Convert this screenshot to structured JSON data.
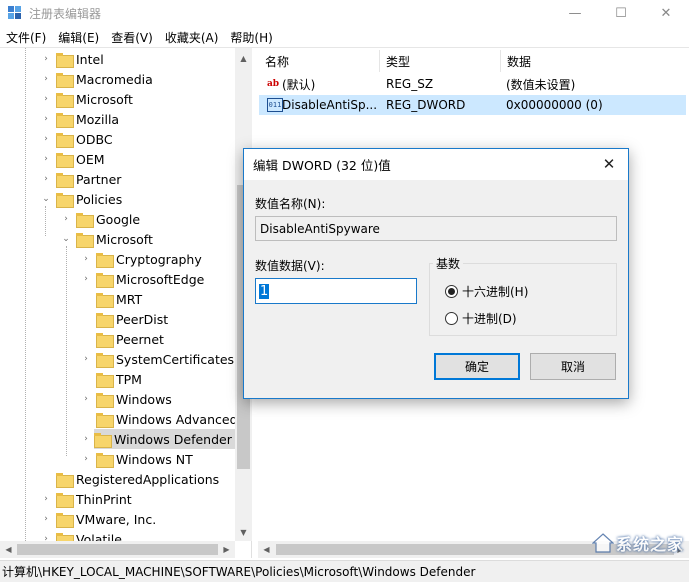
{
  "window": {
    "title": "注册表编辑器",
    "controls": {
      "minimize": "—",
      "maximize": "☐",
      "close": "✕"
    }
  },
  "menubar": {
    "items": [
      "文件(F)",
      "编辑(E)",
      "查看(V)",
      "收藏夹(A)",
      "帮助(H)"
    ]
  },
  "tree": {
    "items": [
      {
        "label": "Intel",
        "expander": "›",
        "level": 2
      },
      {
        "label": "Macromedia",
        "expander": "›",
        "level": 2
      },
      {
        "label": "Microsoft",
        "expander": "›",
        "level": 2
      },
      {
        "label": "Mozilla",
        "expander": "›",
        "level": 2
      },
      {
        "label": "ODBC",
        "expander": "›",
        "level": 2
      },
      {
        "label": "OEM",
        "expander": "›",
        "level": 2
      },
      {
        "label": "Partner",
        "expander": "›",
        "level": 2
      },
      {
        "label": "Policies",
        "expander": "⌄",
        "level": 2
      },
      {
        "label": "Google",
        "expander": "›",
        "level": 3
      },
      {
        "label": "Microsoft",
        "expander": "⌄",
        "level": 3
      },
      {
        "label": "Cryptography",
        "expander": "›",
        "level": 4
      },
      {
        "label": "MicrosoftEdge",
        "expander": "›",
        "level": 4
      },
      {
        "label": "MRT",
        "expander": "",
        "level": 4
      },
      {
        "label": "PeerDist",
        "expander": "",
        "level": 4
      },
      {
        "label": "Peernet",
        "expander": "",
        "level": 4
      },
      {
        "label": "SystemCertificates",
        "expander": "›",
        "level": 4
      },
      {
        "label": "TPM",
        "expander": "",
        "level": 4
      },
      {
        "label": "Windows",
        "expander": "›",
        "level": 4
      },
      {
        "label": "Windows Advanced",
        "expander": "",
        "level": 4
      },
      {
        "label": "Windows Defender",
        "expander": "›",
        "level": 4,
        "selected": true
      },
      {
        "label": "Windows NT",
        "expander": "›",
        "level": 4
      },
      {
        "label": "RegisteredApplications",
        "expander": "",
        "level": 2
      },
      {
        "label": "ThinPrint",
        "expander": "›",
        "level": 2
      },
      {
        "label": "VMware, Inc.",
        "expander": "›",
        "level": 2
      },
      {
        "label": "Volatile",
        "expander": "›",
        "level": 2
      }
    ]
  },
  "list": {
    "headers": {
      "name": "名称",
      "type": "类型",
      "data": "数据"
    },
    "rows": [
      {
        "icon": "string-value-icon",
        "icon_text": "ab",
        "name": "(默认)",
        "type": "REG_SZ",
        "data": "(数值未设置)",
        "selected": false
      },
      {
        "icon": "binary-value-icon",
        "icon_text": "011",
        "name": "DisableAntiSp...",
        "type": "REG_DWORD",
        "data": "0x00000000 (0)",
        "selected": true
      }
    ]
  },
  "statusbar": {
    "path": "计算机\\HKEY_LOCAL_MACHINE\\SOFTWARE\\Policies\\Microsoft\\Windows Defender"
  },
  "dialog": {
    "title": "编辑 DWORD (32 位)值",
    "close": "✕",
    "name_label": "数值名称(N):",
    "name_value": "DisableAntiSpyware",
    "data_label": "数值数据(V):",
    "data_value": "1",
    "base_label": "基数",
    "radio_hex": "十六进制(H)",
    "radio_dec": "十进制(D)",
    "selected_base": "hex",
    "ok_label": "确定",
    "cancel_label": "取消"
  },
  "watermark": {
    "text": "系统之家"
  },
  "colors": {
    "accent": "#0078d7",
    "selection_list": "#cce8ff",
    "selection_tree": "#d9d9d9",
    "folder": "#f7d56b"
  }
}
